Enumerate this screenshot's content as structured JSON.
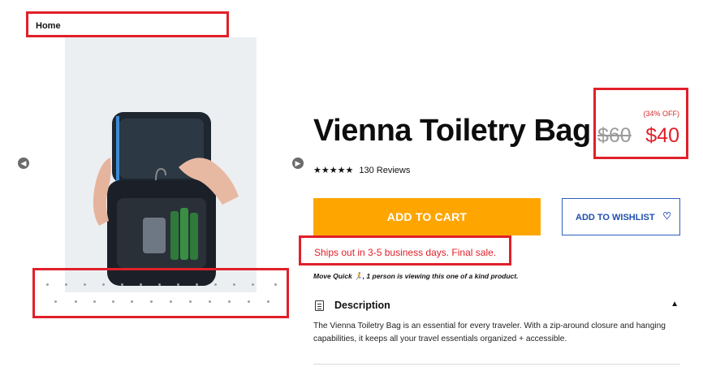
{
  "breadcrumb": {
    "home": "Home"
  },
  "carousel": {
    "prev_icon": "chevron-left-icon",
    "next_icon": "chevron-right-icon"
  },
  "product": {
    "title": "Vienna Toiletry Bag",
    "discount": "(34% OFF)",
    "old_price": "$60",
    "new_price": "$40",
    "stars": "★★★★★",
    "reviews": "130 Reviews",
    "add_to_cart": "ADD TO CART",
    "wishlist": "ADD TO WISHLIST",
    "shipping_note": "Ships out in 3-5 business days. Final sale.",
    "viewing_prefix": "Move Quick",
    "viewing_emoji": "🏃",
    "viewing_text": ", 1 person is viewing this one of a kind product.",
    "description_title": "Description",
    "description": "The Vienna Toiletry Bag is an essential for every traveler. With a zip-around closure and hanging capabilities, it keeps all your travel essentials organized + accessible."
  },
  "colors": {
    "accent_orange": "#ffa500",
    "sale_red": "#e0202a",
    "link_blue": "#1f4fb0",
    "highlight_border": "#e0202a"
  }
}
